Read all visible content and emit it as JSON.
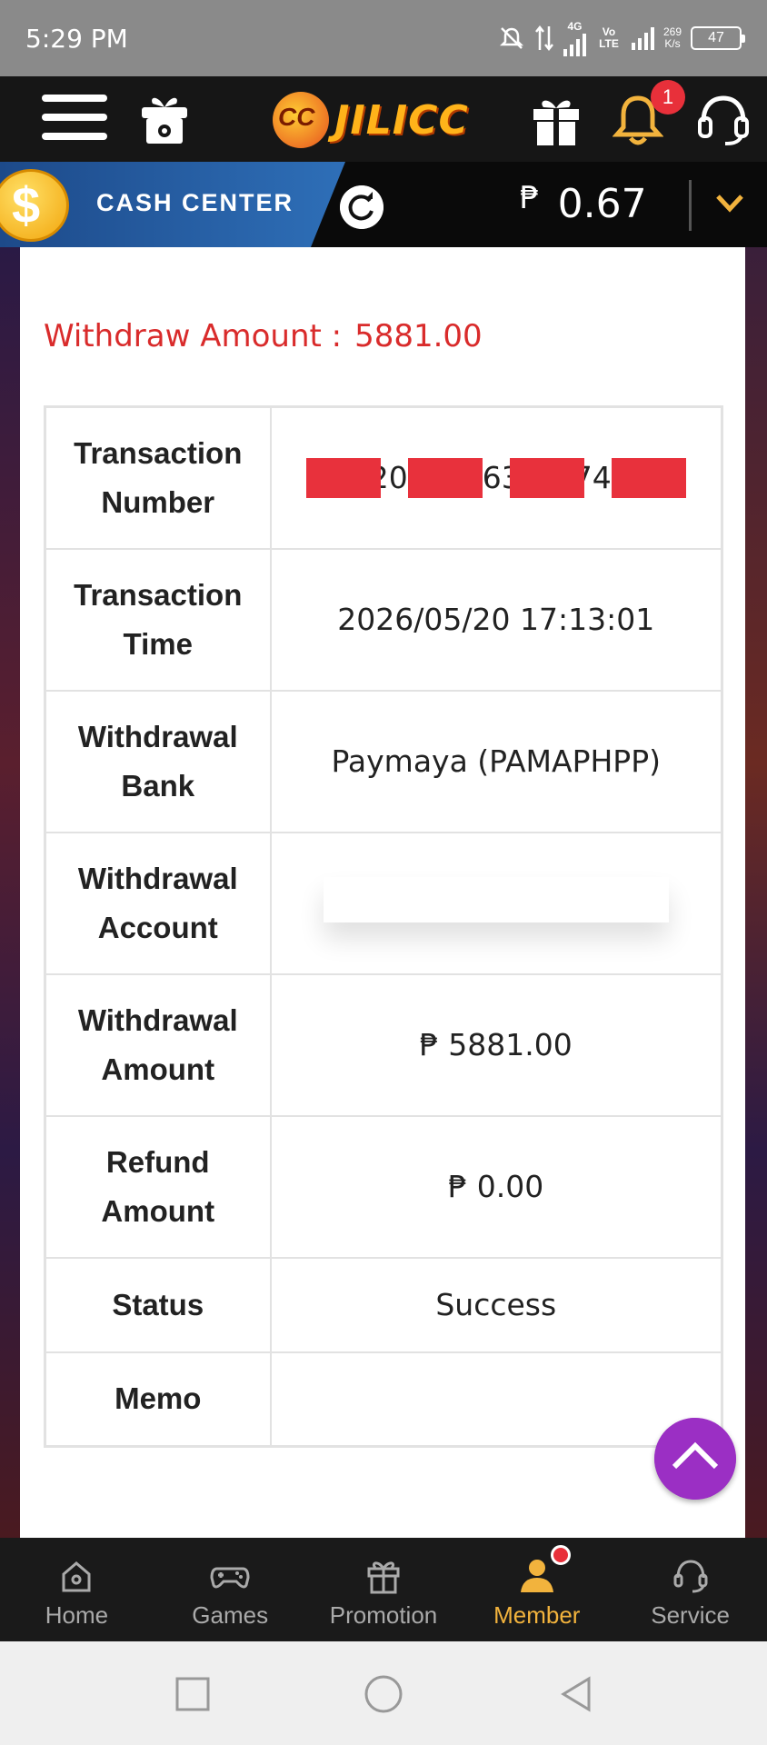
{
  "status_bar": {
    "time": "5:29 PM",
    "network": "4G",
    "volte": "Vo LTE",
    "speed_value": "269",
    "speed_unit": "K/s",
    "battery": "47"
  },
  "header": {
    "logo_text": "JILICC",
    "notification_count": "1"
  },
  "cash_center": {
    "label": "CASH CENTER",
    "currency_symbol": "₱",
    "balance": "0.67"
  },
  "withdraw": {
    "amount_label": "Withdraw Amount :",
    "amount_value": "5881.00"
  },
  "details": {
    "rows": [
      {
        "label": "Transaction Number",
        "value": ""
      },
      {
        "label": "Transaction Time",
        "value": "2026/05/20 17:13:01"
      },
      {
        "label": "Withdrawal Bank",
        "value": "Paymaya (PAMAPHPP)"
      },
      {
        "label": "Withdrawal Account",
        "value": ""
      },
      {
        "label": "Withdrawal Amount",
        "value": "₱ 5881.00"
      },
      {
        "label": "Refund Amount",
        "value": "₱ 0.00"
      },
      {
        "label": "Status",
        "value": "Success"
      },
      {
        "label": "Memo",
        "value": ""
      }
    ],
    "txn_fragments": [
      "20",
      "63",
      "74"
    ]
  },
  "bottom_nav": {
    "items": [
      {
        "label": "Home",
        "icon": "home-icon"
      },
      {
        "label": "Games",
        "icon": "gamepad-icon"
      },
      {
        "label": "Promotion",
        "icon": "gift-icon"
      },
      {
        "label": "Member",
        "icon": "user-icon"
      },
      {
        "label": "Service",
        "icon": "headset-icon"
      }
    ],
    "active": "Member"
  },
  "colors": {
    "accent_red": "#d92b2b",
    "active_nav": "#f2b33d",
    "scroll_button": "#9b2fc4"
  }
}
